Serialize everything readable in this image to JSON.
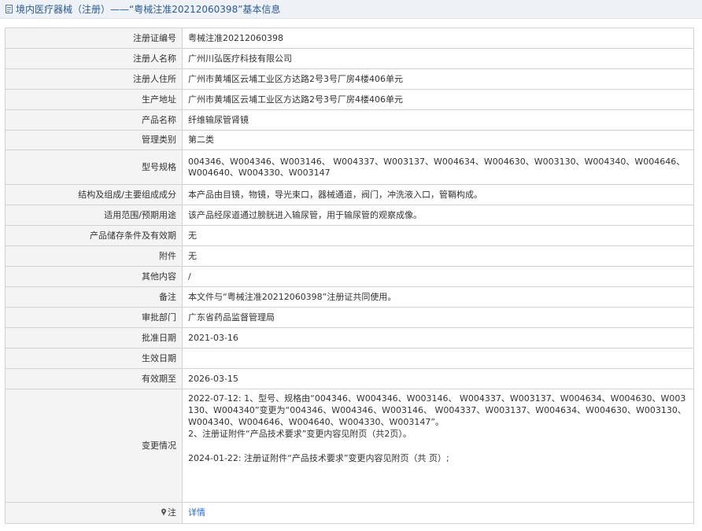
{
  "header": {
    "title": "境内医疗器械（注册）——“粤械注准20212060398”基本信息"
  },
  "rows": [
    {
      "label": "注册证编号",
      "value": "粤械注准20212060398"
    },
    {
      "label": "注册人名称",
      "value": "广州川弘医疗科技有限公司"
    },
    {
      "label": "注册人住所",
      "value": "广州市黄埔区云埔工业区方达路2号3号厂房4楼406单元"
    },
    {
      "label": "生产地址",
      "value": "广州市黄埔区云埔工业区方达路2号3号厂房4楼406单元"
    },
    {
      "label": "产品名称",
      "value": "纤维输尿管肾镜"
    },
    {
      "label": "管理类别",
      "value": "第二类"
    },
    {
      "label": "型号规格",
      "value": "004346、W004346、W003146、 W004337、W003137、W004634、W004630、W003130、W004340、W004646、W004640、W004330、W003147"
    },
    {
      "label": "结构及组成/主要组成成分",
      "value": "本产品由目镜，物镜，导光束口，器械通道，阀门，冲洗液入口，管鞘构成。"
    },
    {
      "label": "适用范围/预期用途",
      "value": "该产品经尿道通过膀胱进入输尿管，用于输尿管的观察成像。"
    },
    {
      "label": "产品储存条件及有效期",
      "value": "无"
    },
    {
      "label": "附件",
      "value": "无"
    },
    {
      "label": "其他内容",
      "value": "/"
    },
    {
      "label": "备注",
      "value": "本文件与“粤械注准20212060398”注册证共同使用。"
    },
    {
      "label": "审批部门",
      "value": "广东省药品监督管理局"
    },
    {
      "label": "批准日期",
      "value": "2021-03-16"
    },
    {
      "label": "生效日期",
      "value": ""
    },
    {
      "label": "有效期至",
      "value": "2026-03-15"
    }
  ],
  "changes": {
    "label": "变更情况",
    "lines": [
      "2022-07-12: 1、型号、规格由“004346、W004346、W003146、 W004337、W003137、W004634、W004630、W003130、W004340”变更为“004346、W004346、W003146、 W004337、W003137、W004634、W004630、W003130、W004340、W004646、W004640、W004330、W003147”。",
      "2、注册证附件“产品技术要求”变更内容见附页（共2页）。",
      "2024-01-22: 注册证附件“产品技术要求”变更内容见附页（共 页）;"
    ]
  },
  "note": {
    "label": "注",
    "link": "详情"
  }
}
